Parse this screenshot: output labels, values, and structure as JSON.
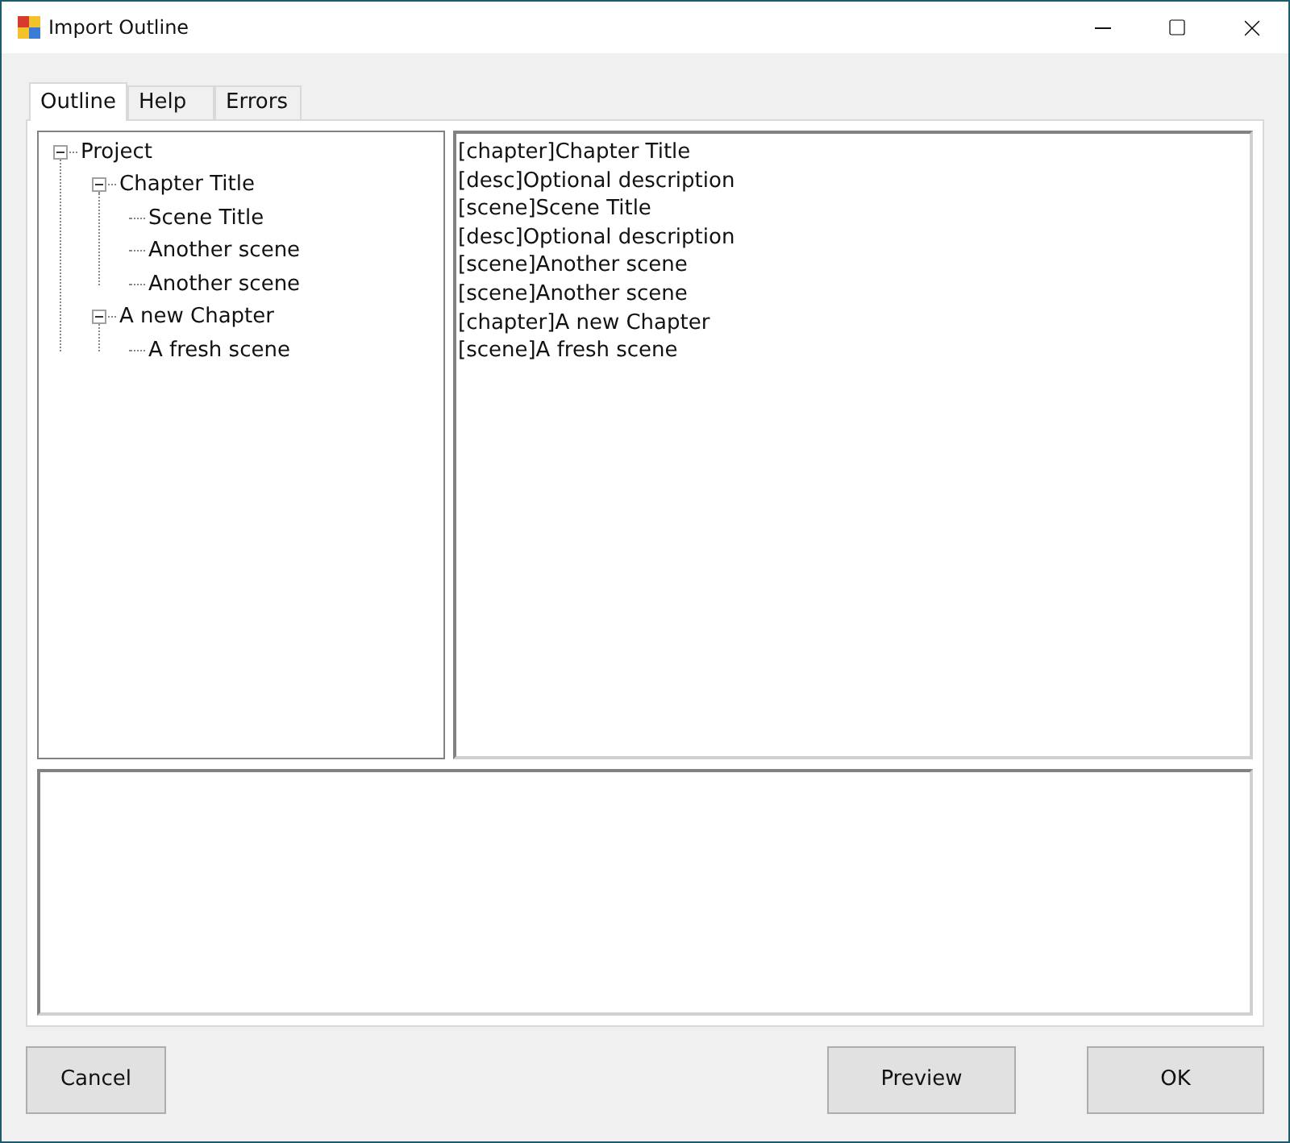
{
  "window": {
    "title": "Import Outline"
  },
  "tabs": [
    {
      "label": "Outline",
      "selected": true
    },
    {
      "label": "Help",
      "selected": false
    },
    {
      "label": "Errors",
      "selected": false
    }
  ],
  "tree": [
    {
      "label": "Project",
      "expanded": true,
      "children": [
        {
          "label": "Chapter Title",
          "expanded": true,
          "children": [
            {
              "label": "Scene Title"
            },
            {
              "label": "Another scene"
            },
            {
              "label": "Another scene"
            }
          ]
        },
        {
          "label": "A new Chapter",
          "expanded": true,
          "children": [
            {
              "label": "A fresh scene"
            }
          ]
        }
      ]
    }
  ],
  "outline_text": [
    "[chapter]Chapter Title",
    "[desc]Optional description",
    "[scene]Scene Title",
    "[desc]Optional description",
    "[scene]Another scene",
    "[scene]Another scene",
    "[chapter]A new Chapter",
    "[scene]A fresh scene"
  ],
  "buttons": {
    "cancel": "Cancel",
    "preview": "Preview",
    "ok": "OK"
  }
}
